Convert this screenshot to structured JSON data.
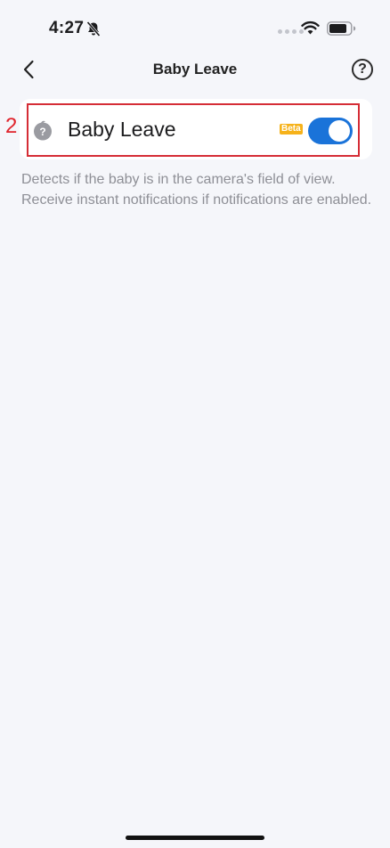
{
  "status_bar": {
    "time": "4:27",
    "icons": [
      "bell-off-icon",
      "signal-icon",
      "wifi-icon",
      "battery-icon"
    ]
  },
  "nav": {
    "title": "Baby Leave",
    "back_icon": "chevron-left-icon",
    "help_label": "?"
  },
  "annotation": {
    "number": "2",
    "color": "#e0242c"
  },
  "setting": {
    "icon": "baby-head-icon",
    "label": "Baby Leave",
    "badge": "Beta",
    "enabled": true
  },
  "description": "Detects if the baby is in the camera's field of view. Receive instant notifications if notifications are enabled.",
  "colors": {
    "accent": "#1a73d9",
    "badge": "#f6b21a",
    "highlight": "#d52d36",
    "background": "#f5f6fa"
  }
}
